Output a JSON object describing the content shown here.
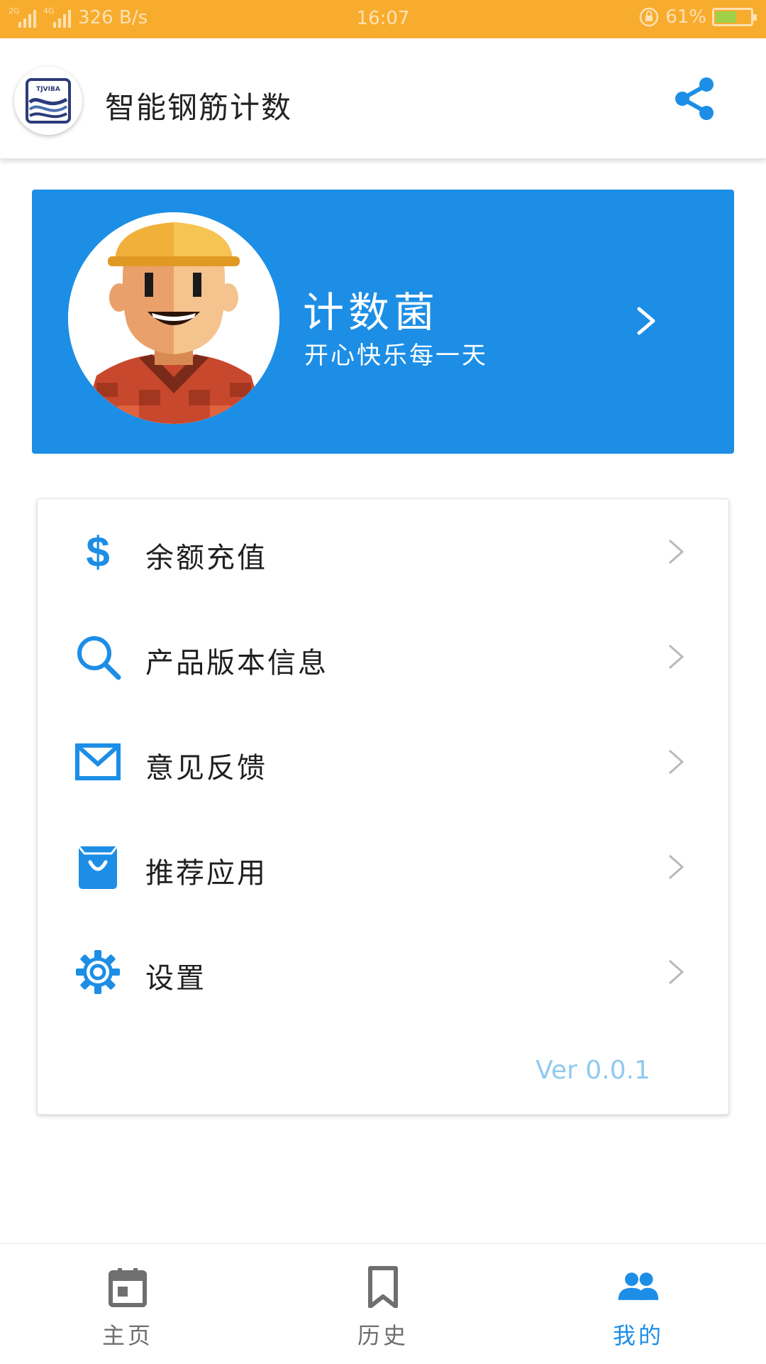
{
  "status_bar": {
    "sim1": "2G",
    "sim2": "4G",
    "speed": "326 B/s",
    "time": "16:07",
    "battery": "61%",
    "battery_level": 0.61
  },
  "app_bar": {
    "logo_text": "TJVIBA",
    "title": "智能钢筋计数",
    "share_icon": "share-icon"
  },
  "profile": {
    "name": "计数菌",
    "motto": "开心快乐每一天",
    "chevron_icon": "chevron-right-icon"
  },
  "menu": {
    "items": [
      {
        "label": "余额充值",
        "icon": "dollar-icon"
      },
      {
        "label": "产品版本信息",
        "icon": "search-icon"
      },
      {
        "label": "意见反馈",
        "icon": "mail-icon"
      },
      {
        "label": "推荐应用",
        "icon": "shopping-bag-icon"
      },
      {
        "label": "设置",
        "icon": "gear-icon"
      }
    ],
    "version": "Ver 0.0.1"
  },
  "bottom_nav": {
    "items": [
      {
        "label": "主页",
        "icon": "calendar-icon",
        "active": false
      },
      {
        "label": "历史",
        "icon": "bookmark-icon",
        "active": false
      },
      {
        "label": "我的",
        "icon": "people-icon",
        "active": true
      }
    ]
  },
  "colors": {
    "status_bar": "#f8ac2e",
    "primary": "#1c8ee6",
    "version_text": "#8fcaf0",
    "inactive_nav": "#6f6f6f"
  }
}
